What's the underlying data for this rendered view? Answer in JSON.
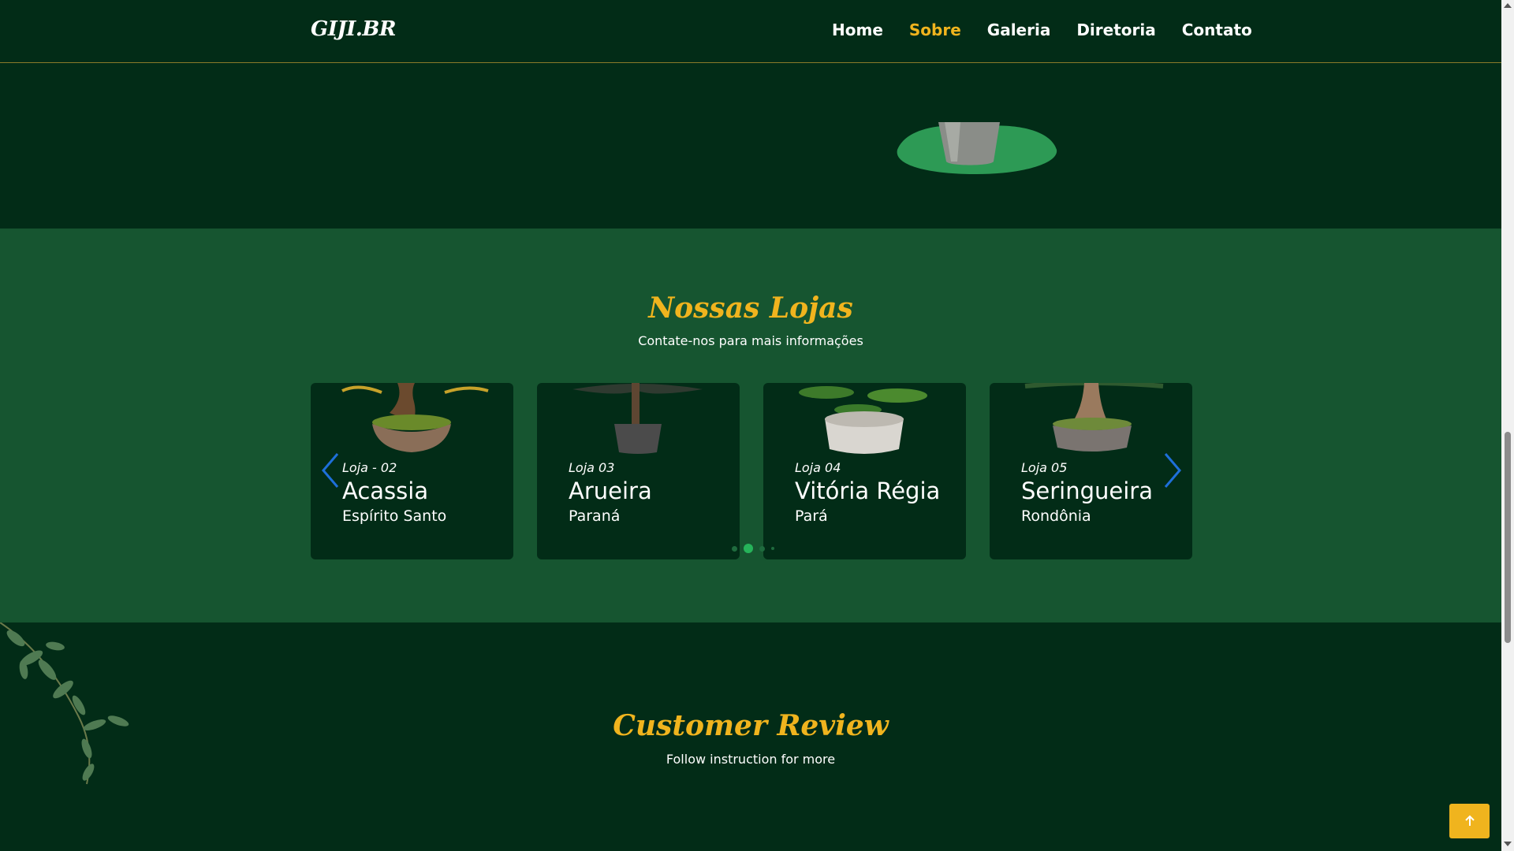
{
  "header": {
    "logo": "GIJI.BR",
    "nav": [
      {
        "label": "Home",
        "active": false
      },
      {
        "label": "Sobre",
        "active": true
      },
      {
        "label": "Galeria",
        "active": false
      },
      {
        "label": "Diretoria",
        "active": false
      },
      {
        "label": "Contato",
        "active": false
      }
    ]
  },
  "stores": {
    "title": "Nossas Lojas",
    "subtitle": "Contate-nos para mais informações",
    "cards": [
      {
        "kicker": "Loja - 02",
        "name": "Acassia",
        "state": "Espírito Santo"
      },
      {
        "kicker": "Loja 03",
        "name": "Arueira",
        "state": "Paraná"
      },
      {
        "kicker": "Loja 04",
        "name": "Vitória Régia",
        "state": "Pará"
      },
      {
        "kicker": "Loja 05",
        "name": "Seringueira",
        "state": "Rondônia"
      }
    ],
    "prev_icon": "chevron-left-icon",
    "next_icon": "chevron-right-icon",
    "pagination": {
      "total": 4,
      "active": 1
    }
  },
  "review": {
    "title": "Customer Review",
    "subtitle": "Follow instruction for more"
  },
  "to_top_icon": "arrow-up-icon",
  "colors": {
    "accent": "#f0b41e",
    "dark_green": "#022c17",
    "section_green": "#165530",
    "arrow_blue": "#1e6fd9"
  }
}
